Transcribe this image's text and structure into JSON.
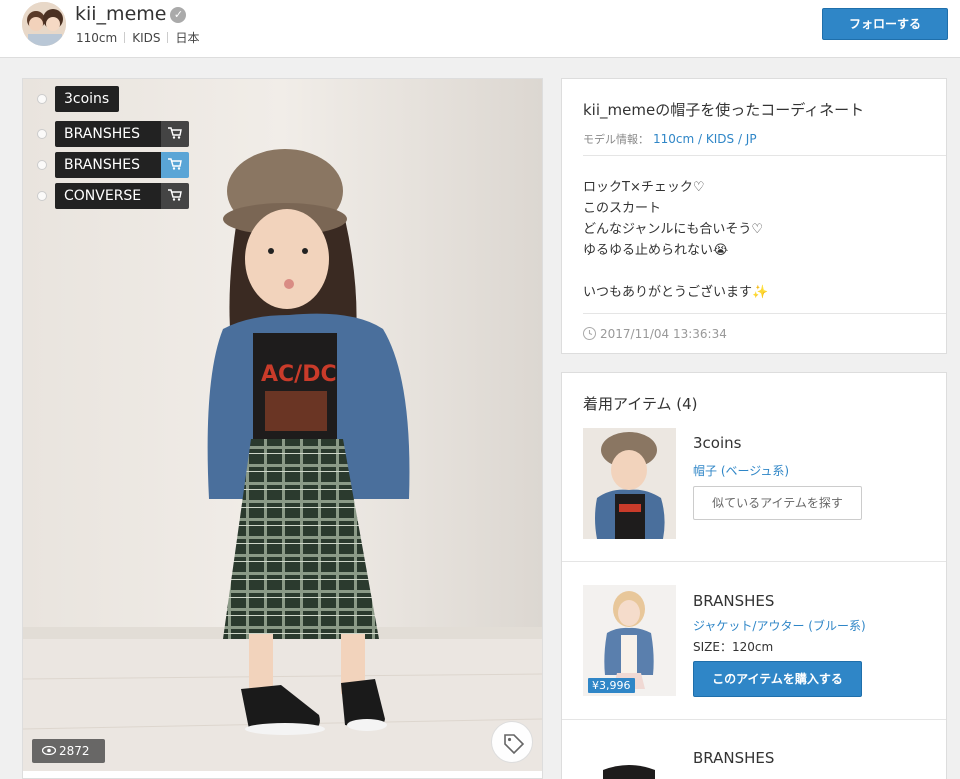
{
  "header": {
    "username": "kii_meme",
    "meta": [
      "110cm",
      "KIDS",
      "日本"
    ],
    "follow_label": "フォローする"
  },
  "photo": {
    "tags": [
      {
        "label": "3coins",
        "cart": false
      },
      {
        "label": "BRANSHES",
        "cart": true,
        "cart_active": false
      },
      {
        "label": "BRANSHES",
        "cart": true,
        "cart_active": true
      },
      {
        "label": "CONVERSE",
        "cart": true,
        "cart_active": false
      }
    ],
    "views": "2872",
    "icons": {
      "views": "eye-icon",
      "tag": "tag-icon",
      "cart": "cart-icon"
    }
  },
  "info": {
    "title": "kii_memeの帽子を使ったコーディネート",
    "model_label": "モデル情報：",
    "model_value": "110cm / KIDS / JP",
    "description": "ロックT×チェック♡\nこのスカート\nどんなジャンルにも合いそう♡\nゆるゆる止められない😭\n\nいつもありがとうございます✨",
    "date": "2017/11/04 13:36:34"
  },
  "items": {
    "title": "着用アイテム (4)",
    "list": [
      {
        "brand": "3coins",
        "category": "帽子 (ベージュ系)",
        "button": "似ているアイテムを探す"
      },
      {
        "brand": "BRANSHES",
        "category": "ジャケット/アウター (ブルー系)",
        "size": "SIZE：120cm",
        "price": "¥3,996",
        "button": "このアイテムを購入する"
      },
      {
        "brand": "BRANSHES"
      }
    ]
  },
  "colors": {
    "accent": "#2f86c7",
    "tag_bg": "#222222",
    "cart_active": "#5aa5d6"
  }
}
